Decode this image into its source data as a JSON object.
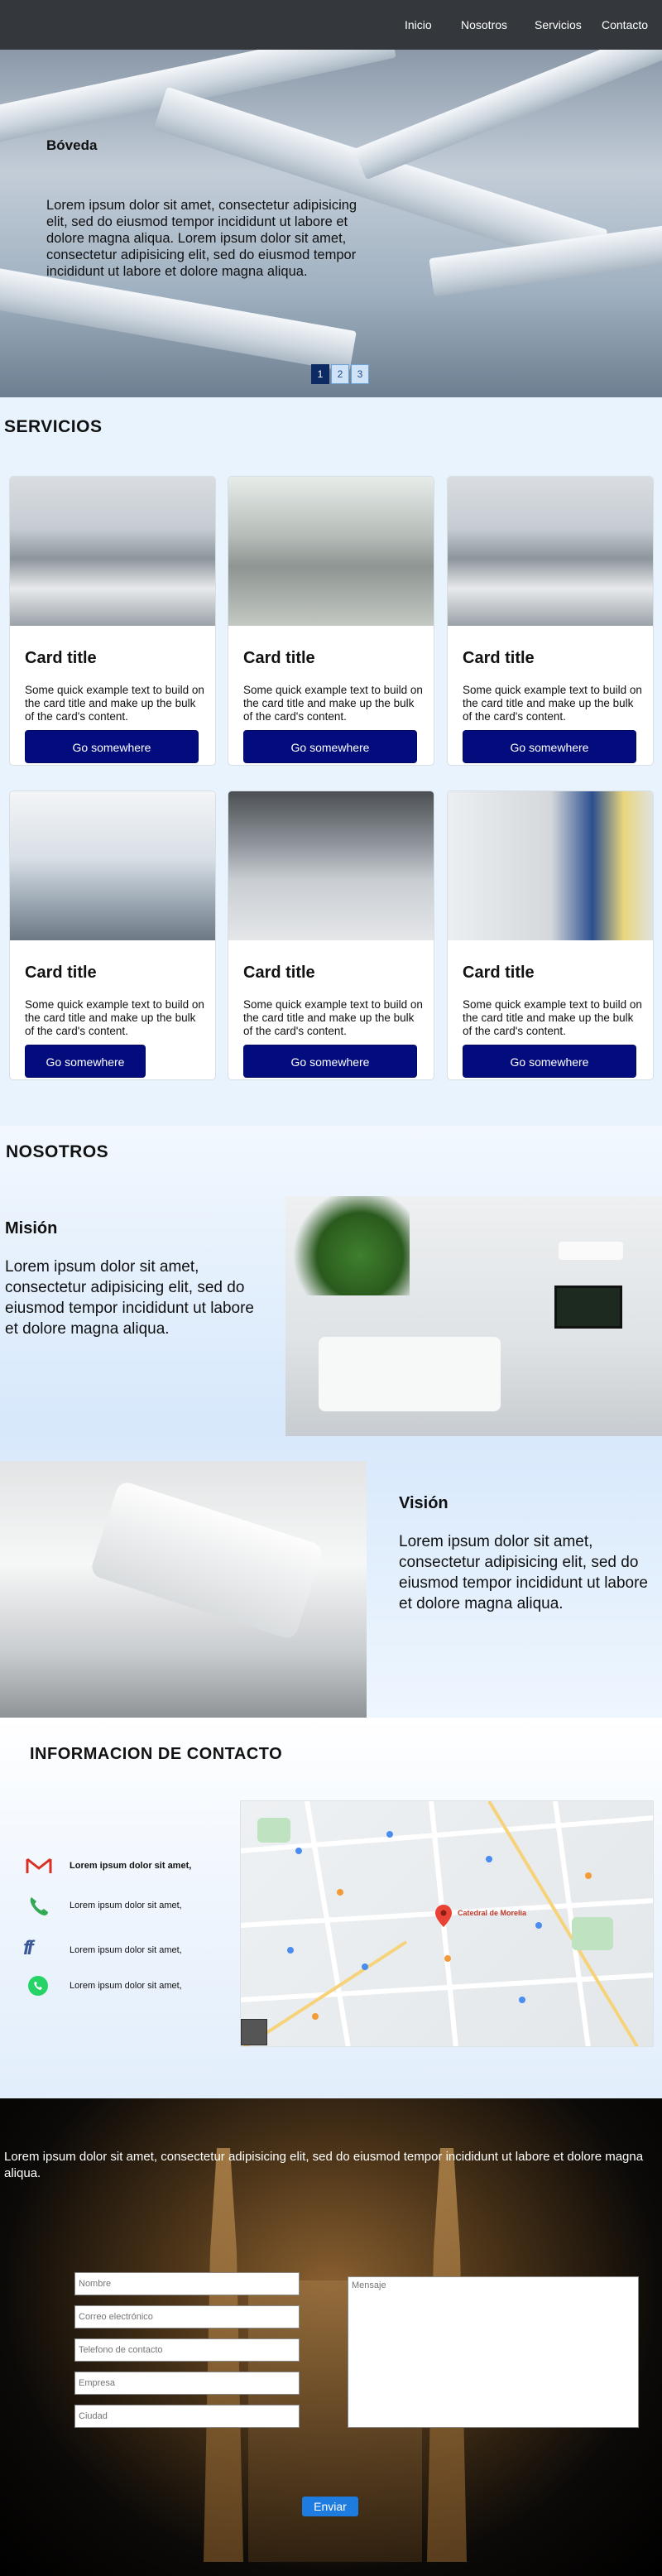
{
  "nav": {
    "items": [
      "Inicio",
      "Nosotros",
      "Servicios",
      "Contacto"
    ]
  },
  "hero": {
    "title": "Bóveda",
    "text": "Lorem ipsum dolor sit amet, consectetur adipisicing elit, sed do eiusmod tempor incididunt ut labore et dolore magna aliqua. Lorem ipsum dolor sit amet, consectetur adipisicing elit, sed do eiusmod tempor incididunt ut labore et dolore magna aliqua.",
    "pages": [
      "1",
      "2",
      "3"
    ],
    "active_page": "1"
  },
  "servicios": {
    "title": "SERVICIOS",
    "cards": [
      {
        "title": "Card title",
        "text": "Some quick example text to build on the card title and make up the bulk of the card's content.",
        "button": "Go somewhere"
      },
      {
        "title": "Card title",
        "text": "Some quick example text to build on the card title and make up the bulk of the card's content.",
        "button": "Go somewhere"
      },
      {
        "title": "Card title",
        "text": "Some quick example text to build on the card title and make up the bulk of the card's content.",
        "button": "Go somewhere"
      },
      {
        "title": "Card title",
        "text": "Some quick example text to build on the card title and make up the bulk of the card's content.",
        "button": "Go somewhere"
      },
      {
        "title": "Card title",
        "text": "Some quick example text to build on the card title and make up the bulk of the card's content.",
        "button": "Go somewhere"
      },
      {
        "title": "Card title",
        "text": "Some quick example text to build on the card title and make up the bulk of the card's content.",
        "button": "Go somewhere"
      }
    ]
  },
  "nosotros": {
    "title": "NOSOTROS",
    "mision_title": "Misión",
    "mision_text": "Lorem ipsum dolor sit amet, consectetur adipisicing elit, sed do eiusmod tempor incididunt ut labore et dolore magna aliqua.",
    "vision_title": "Visión",
    "vision_text": "Lorem ipsum dolor sit amet, consectetur adipisicing elit, sed do eiusmod tempor incididunt ut labore et dolore magna aliqua."
  },
  "contacto": {
    "title": "INFORMACION DE CONTACTO",
    "items": [
      {
        "icon": "gmail-icon",
        "text": "Lorem ipsum dolor sit amet,"
      },
      {
        "icon": "phone-icon",
        "text": "Lorem ipsum dolor sit amet,"
      },
      {
        "icon": "facebook-icon",
        "text": "Lorem ipsum dolor sit amet,"
      },
      {
        "icon": "whatsapp-icon",
        "text": "Lorem ipsum dolor sit amet,"
      }
    ],
    "map_label": "Catedral de Morelia"
  },
  "form": {
    "intro": "Lorem ipsum dolor sit amet, consectetur adipisicing elit, sed do eiusmod tempor incididunt ut labore et dolore magna aliqua.",
    "placeholders": {
      "nombre": "Nombre",
      "correo": "Correo electrónico",
      "telefono": "Telefono de contacto",
      "empresa": "Empresa",
      "ciudad": "Ciudad",
      "mensaje": "Mensaje"
    },
    "submit": "Enviar"
  },
  "colors": {
    "navbar": "#34383c",
    "button": "#030c7c",
    "submit": "#1e7be0",
    "background": "#e9f3fd"
  }
}
